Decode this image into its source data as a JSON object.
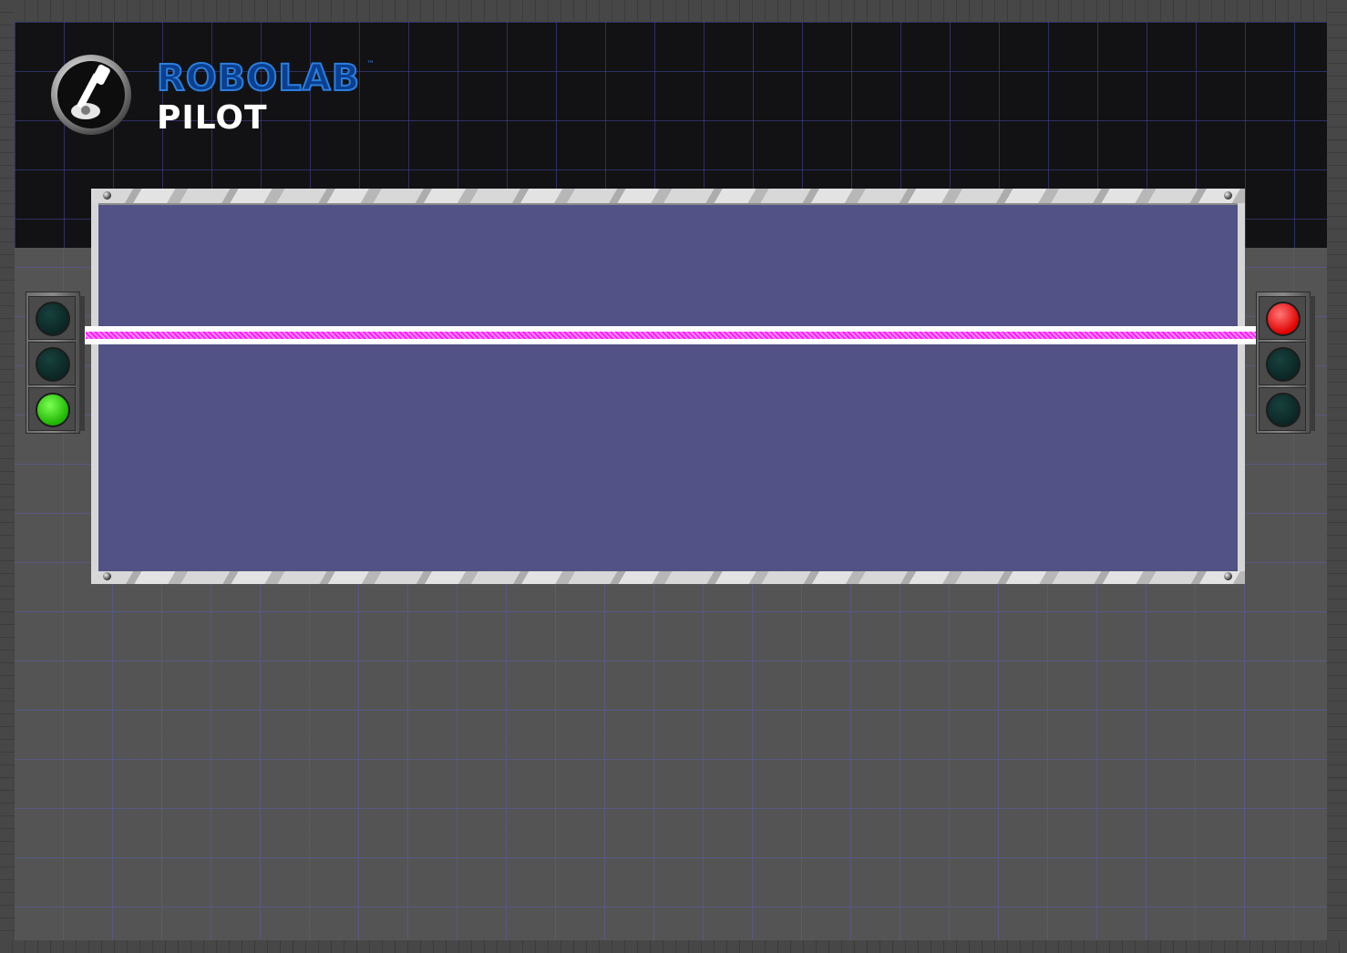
{
  "app": {
    "brand_main": "ROBOLAB",
    "brand_tm": "™",
    "brand_sub": "PILOT"
  },
  "colors": {
    "display_background": "#525286",
    "beam_color": "#ff1aff",
    "lamp_off": "#0b2624",
    "lamp_green": "#1eb400",
    "lamp_red": "#e00000"
  },
  "traffic_lights": {
    "left": {
      "lamps": [
        "off",
        "off",
        "green"
      ]
    },
    "right": {
      "lamps": [
        "red",
        "off",
        "off"
      ]
    }
  },
  "icons": {
    "logo": "joystick-icon"
  }
}
